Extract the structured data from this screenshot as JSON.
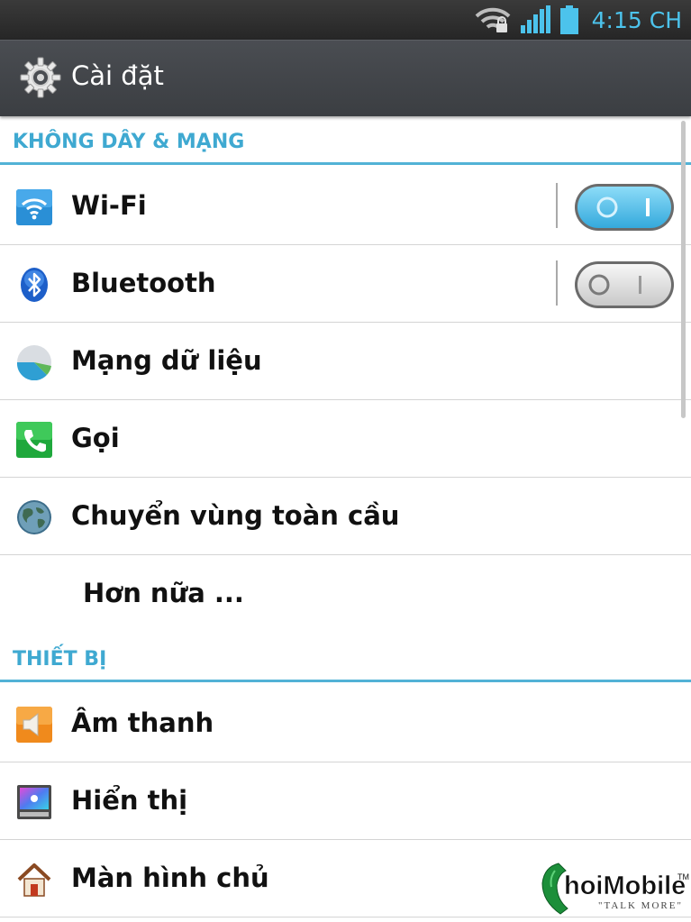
{
  "status_bar": {
    "time": "4:15 CH"
  },
  "action_bar": {
    "title": "Cài đặt"
  },
  "sections": {
    "wireless": {
      "header": "KHÔNG DÂY & MẠNG",
      "items": [
        {
          "label": "Wi-Fi",
          "icon": "wifi-icon",
          "toggle": true
        },
        {
          "label": "Bluetooth",
          "icon": "bluetooth-icon",
          "toggle": false
        },
        {
          "label": "Mạng dữ liệu",
          "icon": "data-usage-icon"
        },
        {
          "label": "Gọi",
          "icon": "phone-icon"
        },
        {
          "label": "Chuyển vùng toàn cầu",
          "icon": "globe-icon"
        },
        {
          "label": "Hơn nữa ..."
        }
      ]
    },
    "device": {
      "header": "THIẾT BỊ",
      "items": [
        {
          "label": "Âm thanh",
          "icon": "speaker-icon"
        },
        {
          "label": "Hiển thị",
          "icon": "display-icon"
        },
        {
          "label": "Màn hình chủ",
          "icon": "home-icon"
        }
      ]
    }
  },
  "watermark": {
    "brand_main": "hoiMobile",
    "brand_tm": "TM",
    "tagline": "\"TALK MORE\""
  },
  "colors": {
    "accent": "#3fa9d1",
    "status_text": "#4cc3ec",
    "toggle_on": "#5ec8ef"
  }
}
